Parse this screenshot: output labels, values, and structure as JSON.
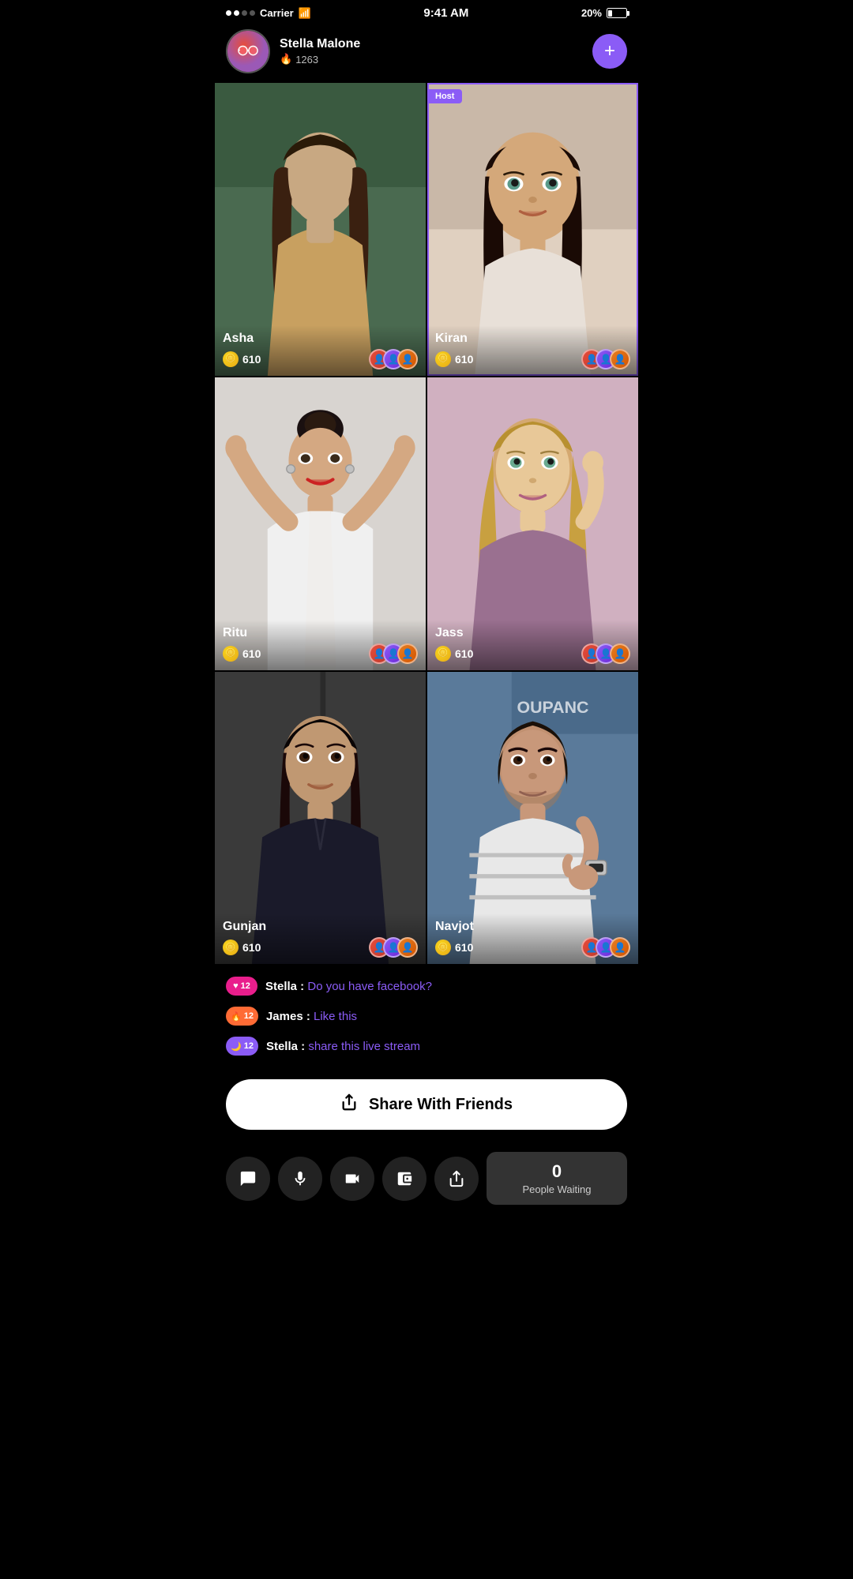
{
  "statusBar": {
    "carrier": "Carrier",
    "time": "9:41 AM",
    "battery": "20%"
  },
  "hostProfile": {
    "name": "Stella Malone",
    "score": "1263",
    "followLabel": "+"
  },
  "streamers": [
    {
      "id": "asha",
      "name": "Asha",
      "coins": "610",
      "isHost": false
    },
    {
      "id": "kiran",
      "name": "Kiran",
      "coins": "610",
      "isHost": true
    },
    {
      "id": "ritu",
      "name": "Ritu",
      "coins": "610",
      "isHost": false
    },
    {
      "id": "jass",
      "name": "Jass",
      "coins": "610",
      "isHost": false
    },
    {
      "id": "gunjan",
      "name": "Gunjan",
      "coins": "610",
      "isHost": false
    },
    {
      "id": "navjot",
      "name": "Navjot",
      "coins": "610",
      "isHost": false
    }
  ],
  "hostBadgeLabel": "Host",
  "chat": {
    "messages": [
      {
        "user": "Stella",
        "badge": "heart",
        "level": "12",
        "text": "Do you have facebook?"
      },
      {
        "user": "James",
        "badge": "fire",
        "level": "12",
        "text": "Like this"
      },
      {
        "user": "Stella",
        "badge": "purple",
        "level": "12",
        "text": "share this live stream"
      }
    ]
  },
  "shareButton": {
    "label": "Share With Friends"
  },
  "bottomBar": {
    "icons": [
      "chat",
      "mic",
      "video",
      "wallet",
      "share"
    ],
    "peopleWaiting": {
      "count": "0",
      "label": "People Waiting"
    }
  }
}
